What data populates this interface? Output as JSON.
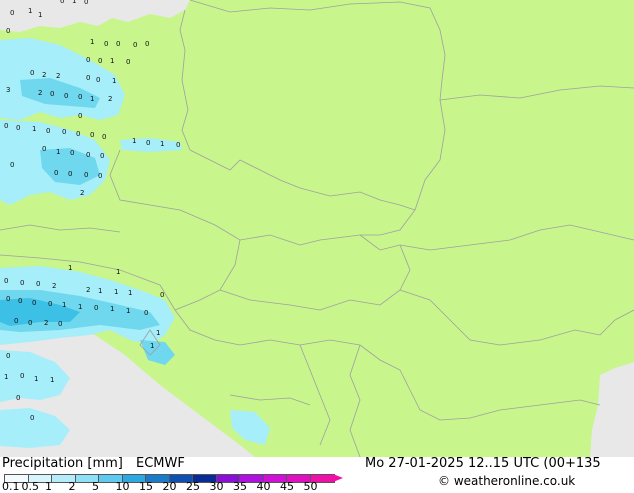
{
  "map": {
    "land_color": "#c8f58c",
    "sea_color": "#e8e8e8",
    "border_color": "#a0a0a0",
    "precip_light": "#a6eefa",
    "precip_mid": "#6fd8ee",
    "precip_strong": "#3cc0e6",
    "numbers": [
      {
        "t": "0"
      },
      {
        "t": "1"
      },
      {
        "t": "0"
      },
      {
        "t": "0"
      },
      {
        "t": "1"
      },
      {
        "t": "1"
      },
      {
        "t": "0"
      },
      {
        "t": "1"
      },
      {
        "t": "0"
      },
      {
        "t": "0"
      },
      {
        "t": "0"
      },
      {
        "t": "0"
      },
      {
        "t": "0"
      },
      {
        "t": "0"
      },
      {
        "t": "1"
      },
      {
        "t": "0"
      },
      {
        "t": "0"
      },
      {
        "t": "2"
      },
      {
        "t": "2"
      },
      {
        "t": "0"
      },
      {
        "t": "0"
      },
      {
        "t": "1"
      },
      {
        "t": "3"
      },
      {
        "t": "2"
      },
      {
        "t": "0"
      },
      {
        "t": "0"
      },
      {
        "t": "0"
      },
      {
        "t": "1"
      },
      {
        "t": "2"
      },
      {
        "t": "0"
      },
      {
        "t": "0"
      },
      {
        "t": "0"
      },
      {
        "t": "1"
      },
      {
        "t": "0"
      },
      {
        "t": "0"
      },
      {
        "t": "0"
      },
      {
        "t": "0"
      },
      {
        "t": "0"
      },
      {
        "t": "1"
      },
      {
        "t": "0"
      },
      {
        "t": "1"
      },
      {
        "t": "0"
      },
      {
        "t": "0"
      },
      {
        "t": "1"
      },
      {
        "t": "0"
      },
      {
        "t": "0"
      },
      {
        "t": "0"
      },
      {
        "t": "0"
      },
      {
        "t": "0"
      },
      {
        "t": "0"
      },
      {
        "t": "0"
      },
      {
        "t": "0"
      },
      {
        "t": "2"
      },
      {
        "t": "1"
      },
      {
        "t": "1"
      },
      {
        "t": "0"
      },
      {
        "t": "0"
      },
      {
        "t": "0"
      },
      {
        "t": "2"
      },
      {
        "t": "2"
      },
      {
        "t": "1"
      },
      {
        "t": "1"
      },
      {
        "t": "1"
      },
      {
        "t": "0"
      },
      {
        "t": "0"
      },
      {
        "t": "0"
      },
      {
        "t": "0"
      },
      {
        "t": "0"
      },
      {
        "t": "1"
      },
      {
        "t": "1"
      },
      {
        "t": "0"
      },
      {
        "t": "1"
      },
      {
        "t": "1"
      },
      {
        "t": "0"
      },
      {
        "t": "0"
      },
      {
        "t": "0"
      },
      {
        "t": "2"
      },
      {
        "t": "0"
      },
      {
        "t": "1"
      },
      {
        "t": "1"
      },
      {
        "t": "0"
      },
      {
        "t": "0"
      },
      {
        "t": "1"
      },
      {
        "t": "1"
      },
      {
        "t": "1"
      },
      {
        "t": "0"
      },
      {
        "t": "0"
      }
    ]
  },
  "footer": {
    "title": "Precipitation [mm]",
    "model": "ECMWF",
    "datetime": "Mo 27-01-2025 12..15 UTC (00+135",
    "credit": "© weatheronline.co.uk",
    "scale": [
      {
        "label": "0.1",
        "color": "#f4fbfe"
      },
      {
        "label": "0.5",
        "color": "#d6f5fc"
      },
      {
        "label": "1",
        "color": "#b4ecfa"
      },
      {
        "label": "2",
        "color": "#8ee0f6"
      },
      {
        "label": "5",
        "color": "#5ccbef"
      },
      {
        "label": "10",
        "color": "#2ea8e0"
      },
      {
        "label": "15",
        "color": "#1a7cc8"
      },
      {
        "label": "20",
        "color": "#1050b0"
      },
      {
        "label": "25",
        "color": "#0a2a96"
      },
      {
        "label": "30",
        "color": "#8a10d8"
      },
      {
        "label": "35",
        "color": "#b010e0"
      },
      {
        "label": "40",
        "color": "#d010d8"
      },
      {
        "label": "45",
        "color": "#e010c0"
      },
      {
        "label": "50",
        "color": "#f010a8"
      }
    ]
  }
}
